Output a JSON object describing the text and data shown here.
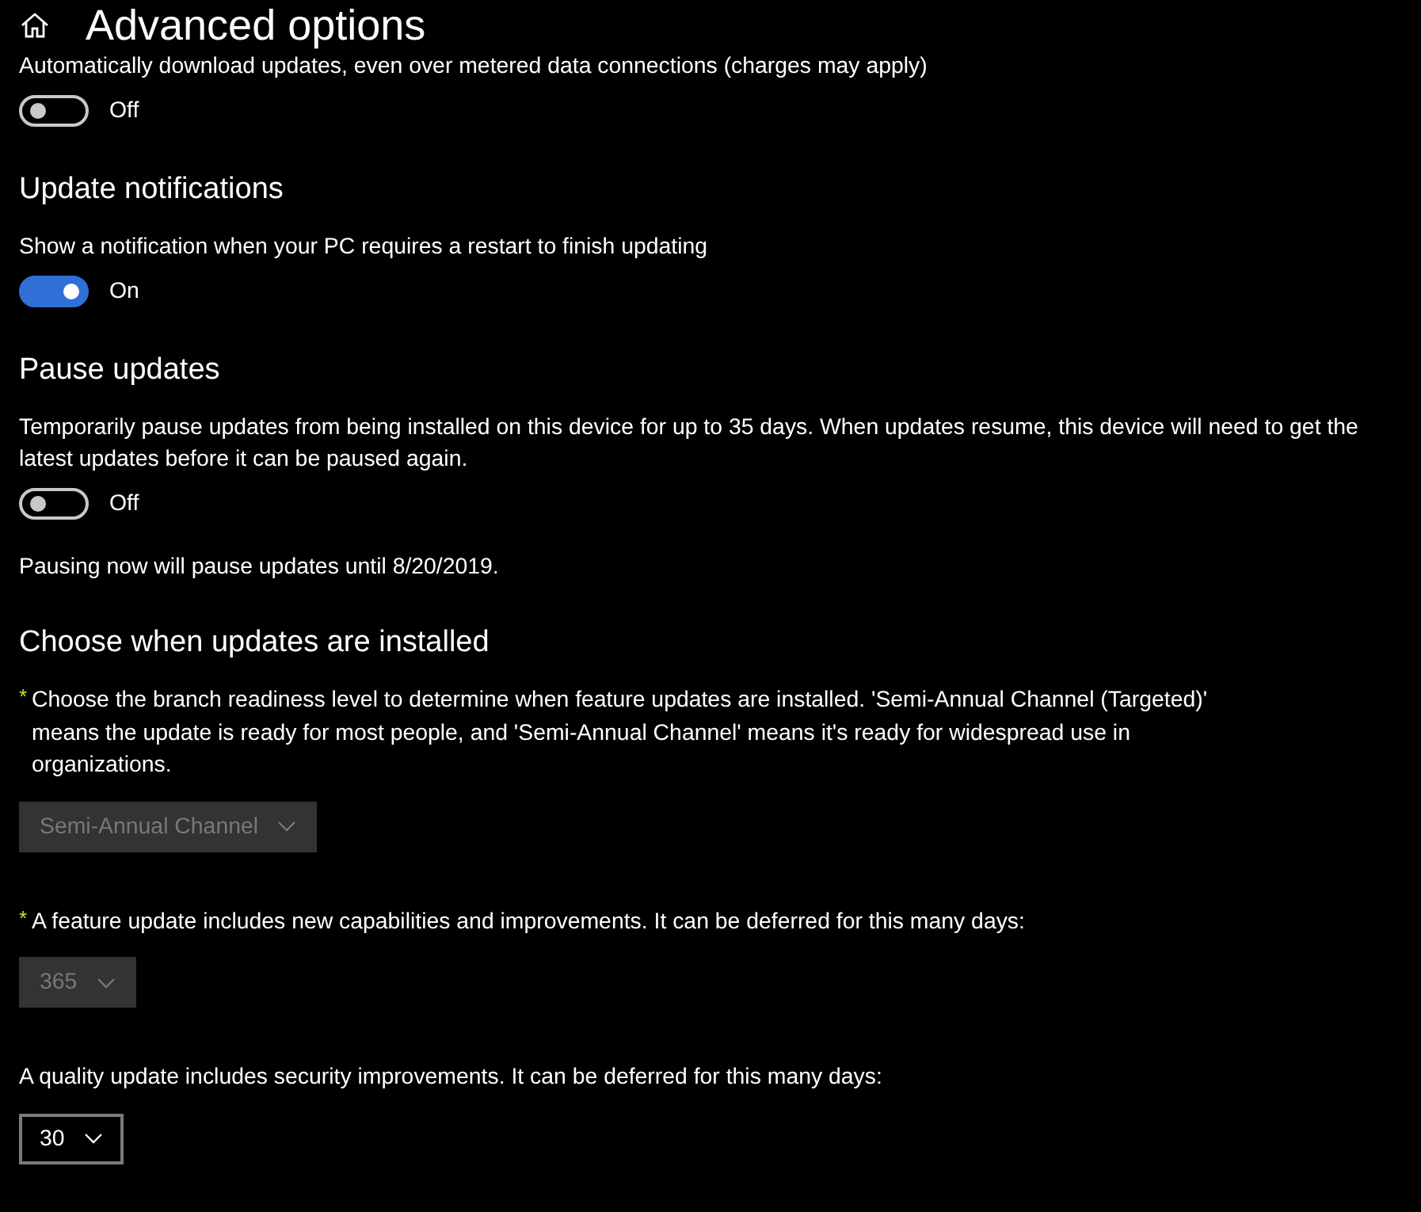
{
  "header": {
    "title": "Advanced options"
  },
  "sections": [
    {
      "kind": "toggle",
      "description": "Automatically download updates, even over metered data connections (charges may apply)",
      "toggle": {
        "on": false,
        "label": "Off"
      }
    },
    {
      "kind": "toggle",
      "heading": "Update notifications",
      "description": "Show a notification when your PC requires a restart to finish updating",
      "toggle": {
        "on": true,
        "label": "On"
      }
    },
    {
      "kind": "toggle",
      "heading": "Pause updates",
      "description": "Temporarily pause updates from being installed on this device for up to 35 days. When updates resume, this device will need to get the latest updates before it can be paused again.",
      "toggle": {
        "on": false,
        "label": "Off"
      },
      "note": "Pausing now will pause updates until 8/20/2019."
    },
    {
      "kind": "dropdowns",
      "heading": "Choose when updates are installed",
      "items": [
        {
          "marker": "*",
          "description": "Choose the branch readiness level to determine when feature updates are installed. 'Semi-Annual Channel (Targeted)' means the update is ready for most people, and 'Semi-Annual Channel' means it's ready for widespread use in organizations.",
          "value": "Semi-Annual Channel",
          "disabled": true
        },
        {
          "marker": "*",
          "description": "A feature update includes new capabilities and improvements. It can be deferred for this many days:",
          "value": "365",
          "disabled": true
        },
        {
          "description": "A quality update includes security improvements. It can be deferred for this many days:",
          "value": "30",
          "disabled": false
        }
      ]
    }
  ]
}
